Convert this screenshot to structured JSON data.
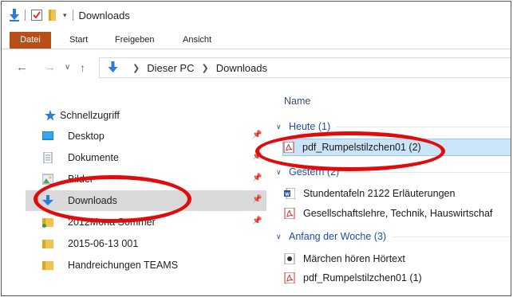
{
  "window": {
    "title": "Downloads"
  },
  "ribbon": {
    "tabs": [
      "Datei",
      "Start",
      "Freigeben",
      "Ansicht"
    ]
  },
  "address": {
    "crumbs": [
      "Dieser PC",
      "Downloads"
    ]
  },
  "nav_pane": {
    "quick_access_label": "Schnellzugriff",
    "items": [
      {
        "label": "Desktop",
        "icon": "desktop-icon",
        "pinned": true
      },
      {
        "label": "Dokumente",
        "icon": "documents-icon",
        "pinned": true
      },
      {
        "label": "Bilder",
        "icon": "pictures-icon",
        "pinned": true
      },
      {
        "label": "Downloads",
        "icon": "downloads-icon",
        "pinned": true,
        "selected": true
      },
      {
        "label": "2012Mona Sommer",
        "icon": "folder-icon",
        "pinned": true
      },
      {
        "label": "2015-06-13 001",
        "icon": "folder-icon",
        "pinned": false
      },
      {
        "label": "Handreichungen TEAMS",
        "icon": "folder-icon",
        "pinned": false
      }
    ]
  },
  "content": {
    "column_header": "Name",
    "groups": [
      {
        "label": "Heute (1)",
        "files": [
          {
            "name": "pdf_Rumpelstilzchen01 (2)",
            "icon": "pdf-icon",
            "selected": true
          }
        ]
      },
      {
        "label": "Gestern (2)",
        "files": [
          {
            "name": "Stundentafeln 2122 Erläuterungen",
            "icon": "word-icon"
          },
          {
            "name": "Gesellschaftslehre, Technik, Hauswirtschaf",
            "icon": "pdf-icon"
          }
        ]
      },
      {
        "label": "Anfang der Woche (3)",
        "files": [
          {
            "name": "Märchen hören Hörtext",
            "icon": "audio-file-icon"
          },
          {
            "name": "pdf_Rumpelstilzchen01 (1)",
            "icon": "pdf-icon"
          }
        ]
      }
    ]
  },
  "colors": {
    "file_tab": "#b84f19",
    "annotation": "#e10b0b",
    "selection": "#cce4f7",
    "nav_selected": "#d9d9d9"
  }
}
